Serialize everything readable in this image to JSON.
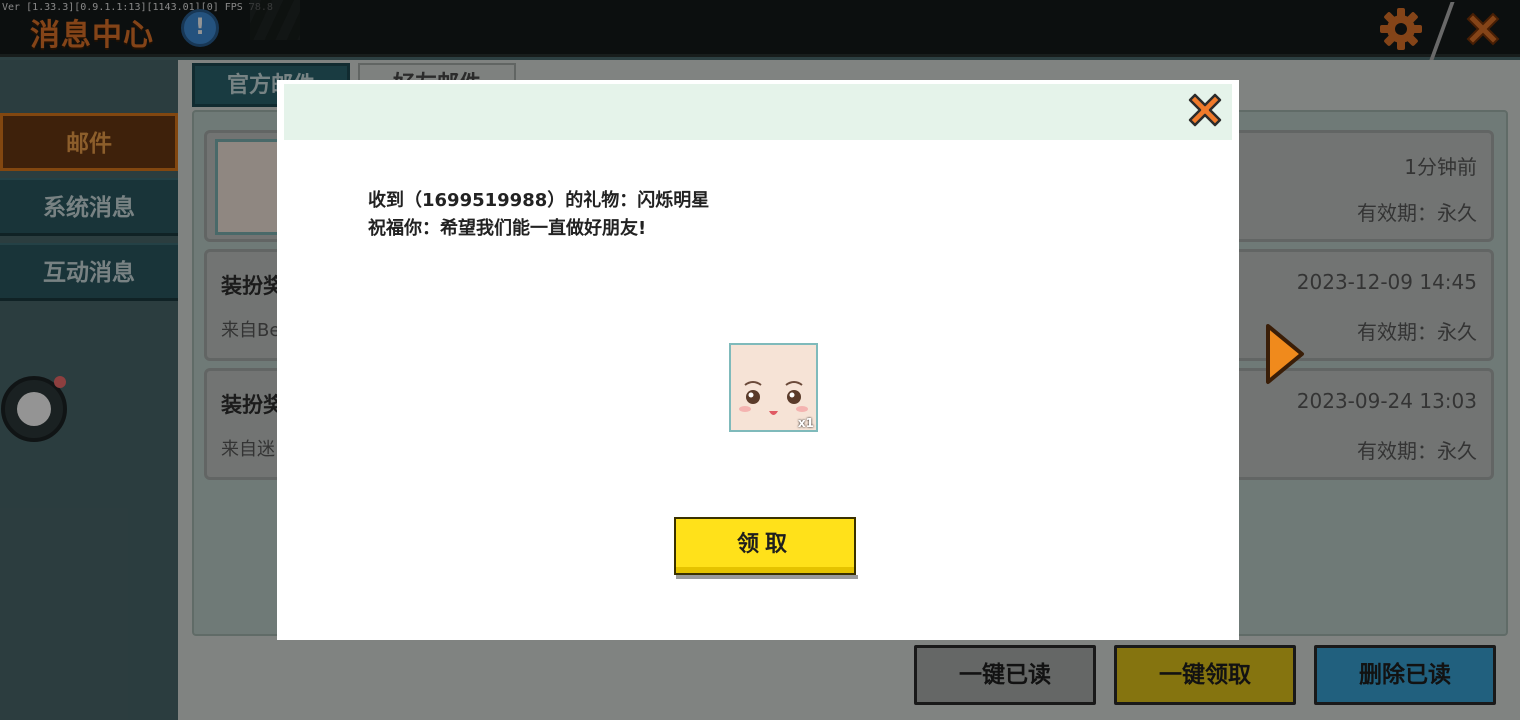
{
  "debug_overlay": "Ver [1.33.3][0.9.1.1:13][1143.01][0] FPS 78.8",
  "header": {
    "title": "消息中心",
    "info_icon": "!",
    "settings_icon": "gear-icon",
    "close_icon": "close-icon"
  },
  "sidebar": {
    "items": [
      {
        "label": "邮件",
        "active": true
      },
      {
        "label": "系统消息",
        "active": false
      },
      {
        "label": "互动消息",
        "active": false
      }
    ]
  },
  "tabs": [
    {
      "label": "官方邮件",
      "active": true
    },
    {
      "label": "好友邮件",
      "active": false
    }
  ],
  "mails": [
    {
      "title": "",
      "from": "",
      "time": "1分钟前",
      "validity": "有效期：永久"
    },
    {
      "title": "装扮奖",
      "from": "来自Be",
      "time": "2023-12-09 14:45",
      "validity": "有效期：永久"
    },
    {
      "title": "装扮奖",
      "from": "来自迷",
      "time": "2023-09-24 13:03",
      "validity": "有效期：永久"
    }
  ],
  "bottom_buttons": {
    "read_all": "一键已读",
    "collect_all": "一键领取",
    "delete_read": "删除已读"
  },
  "modal": {
    "line1": "收到（1699519988）的礼物：闪烁明星",
    "line2": "祝福你：希望我们能一直做好朋友!",
    "gift_qty": "x1",
    "claim_label": "领取"
  },
  "colors": {
    "accent_orange": "#e3762a",
    "collect_yellow": "#ffe11a",
    "delete_blue": "#3aa6d9",
    "nav_teal": "#2c5a63"
  }
}
